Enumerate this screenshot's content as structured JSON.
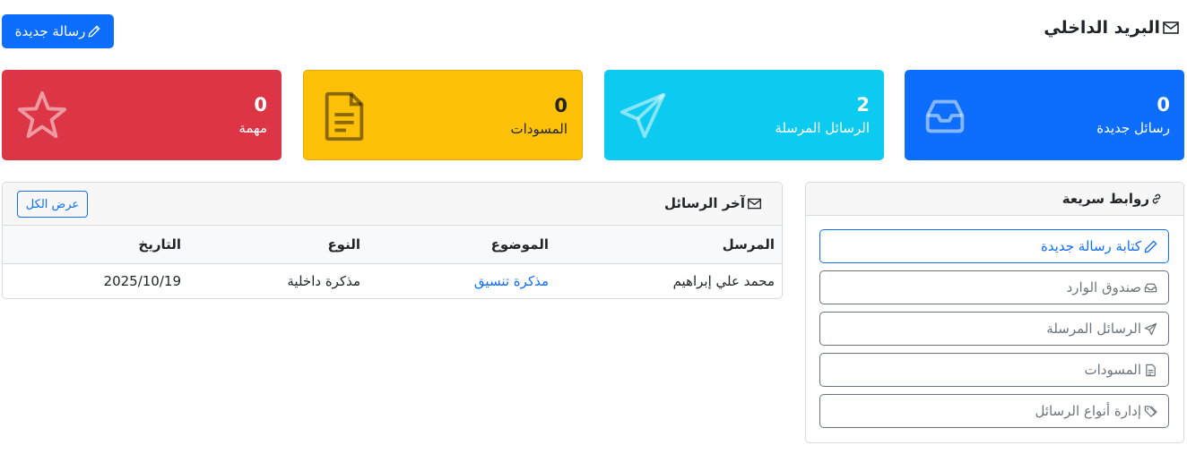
{
  "header": {
    "title": "البريد الداخلي",
    "new_message_button": "رسالة جديدة"
  },
  "stats": {
    "new_messages": {
      "value": "0",
      "label": "رسائل جديدة",
      "color": "#0d6efd",
      "icon": "inbox-icon"
    },
    "sent_messages": {
      "value": "2",
      "label": "الرسائل المرسلة",
      "color": "#0dcaf0",
      "icon": "send-icon"
    },
    "drafts": {
      "value": "0",
      "label": "المسودات",
      "color": "#ffc107",
      "icon": "document-icon"
    },
    "important": {
      "value": "0",
      "label": "مهمة",
      "color": "#dc3545",
      "icon": "star-icon"
    }
  },
  "recent": {
    "title": "آخر الرسائل",
    "view_all_button": "عرض الكل",
    "columns": [
      "المرسل",
      "الموضوع",
      "النوع",
      "التاريخ"
    ],
    "rows": [
      {
        "sender": "محمد علي إبراهيم",
        "subject": "مذكرة تنسيق",
        "type": "مذكرة داخلية",
        "date": "2025/10/19"
      }
    ]
  },
  "quick_links": {
    "title": "روابط سريعة",
    "items": [
      {
        "label": "كتابة رسالة جديدة",
        "icon": "pencil-icon"
      },
      {
        "label": "صندوق الوارد",
        "icon": "inbox-icon"
      },
      {
        "label": "الرسائل المرسلة",
        "icon": "send-icon"
      },
      {
        "label": "المسودات",
        "icon": "document-icon"
      },
      {
        "label": "إدارة أنواع الرسائل",
        "icon": "tags-icon"
      }
    ]
  }
}
